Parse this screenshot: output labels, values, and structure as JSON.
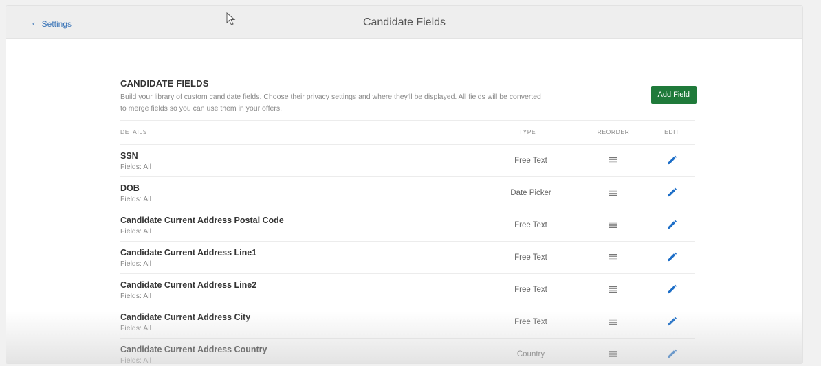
{
  "header": {
    "back_label": "Settings",
    "title": "Candidate Fields"
  },
  "section": {
    "title": "CANDIDATE FIELDS",
    "description": "Build your library of custom candidate fields. Choose their privacy settings and where they'll be displayed. All fields will be converted to merge fields so you can use them in your offers.",
    "add_button_label": "Add Field"
  },
  "table": {
    "columns": {
      "details": "DETAILS",
      "type": "TYPE",
      "reorder": "REORDER",
      "edit": "EDIT"
    },
    "rows": [
      {
        "name": "SSN",
        "fields": "Fields: All",
        "type": "Free Text"
      },
      {
        "name": "DOB",
        "fields": "Fields: All",
        "type": "Date Picker"
      },
      {
        "name": "Candidate Current Address Postal Code",
        "fields": "Fields: All",
        "type": "Free Text"
      },
      {
        "name": "Candidate Current Address Line1",
        "fields": "Fields: All",
        "type": "Free Text"
      },
      {
        "name": "Candidate Current Address Line2",
        "fields": "Fields: All",
        "type": "Free Text"
      },
      {
        "name": "Candidate Current Address City",
        "fields": "Fields: All",
        "type": "Free Text"
      },
      {
        "name": "Candidate Current Address Country",
        "fields": "Fields: All",
        "type": "Country"
      }
    ]
  },
  "icons": {
    "back": "chevron-left-icon",
    "reorder": "drag-handle-icon",
    "edit": "pencil-icon",
    "cursor": "mouse-pointer-icon"
  },
  "colors": {
    "link": "#3a74b7",
    "primary_button": "#1f7a3a",
    "edit_icon": "#1e6fc8"
  }
}
